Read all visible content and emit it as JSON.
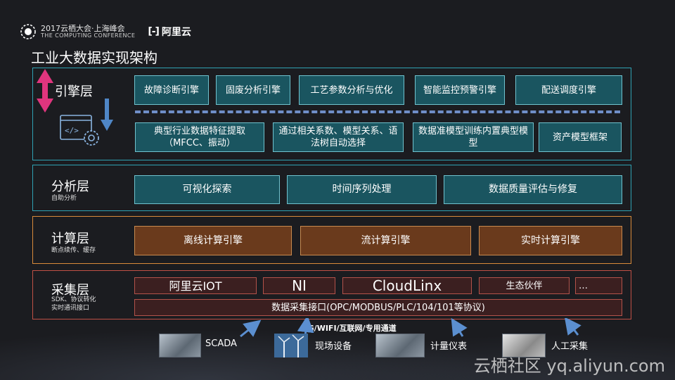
{
  "header": {
    "conference_cn": "2017云栖大会·上海峰会",
    "conference_en": "THE COMPUTING CONFERENCE",
    "aliyun_mark": "[-]",
    "aliyun_name": "阿里云"
  },
  "title": "工业大数据实现架构",
  "layers": {
    "engine": {
      "name": "引擎层",
      "top_boxes": [
        "故障诊断引擎",
        "固废分析引擎",
        "工艺参数分析与优化",
        "智能监控预警引擎",
        "配送调度引擎"
      ],
      "bottom_boxes": [
        "典型行业数据特征提取（MFCC、振动）",
        "通过相关系数、模型关系、语法树自动选择",
        "数据准模型训练内置典型模型",
        "资产模型框架"
      ]
    },
    "analysis": {
      "name": "分析层",
      "sub": "自助分析",
      "boxes": [
        "可视化探索",
        "时间序列处理",
        "数据质量评估与修复"
      ]
    },
    "compute": {
      "name": "计算层",
      "sub": "断点续传、缓存",
      "boxes": [
        "离线计算引擎",
        "流计算引擎",
        "实时计算引擎"
      ]
    },
    "collect": {
      "name": "采集层",
      "sub1": "SDK、协议转化",
      "sub2": "实时通讯接口",
      "boxes": [
        "阿里云IOT",
        "NI",
        "CloudLinx",
        "生态伙伴",
        "…"
      ],
      "interface": "数据采集接口(OPC/MODBUS/PLC/104/101等协议)"
    }
  },
  "channel": "4G/WIFI/互联网/专用通道",
  "sources": [
    "SCADA",
    "现场设备",
    "计量仪表",
    "人工采集"
  ],
  "watermark": "云栖社区 yq.aliyun.com",
  "colors": {
    "engine_border": "#2fa2b3",
    "compute_border": "#d98a3a",
    "collect_border": "#c05046",
    "teal_box": "#1a5560",
    "brown_box": "#6a3a1c",
    "red_box": "#3b1f20",
    "background": "#1b1c20"
  }
}
